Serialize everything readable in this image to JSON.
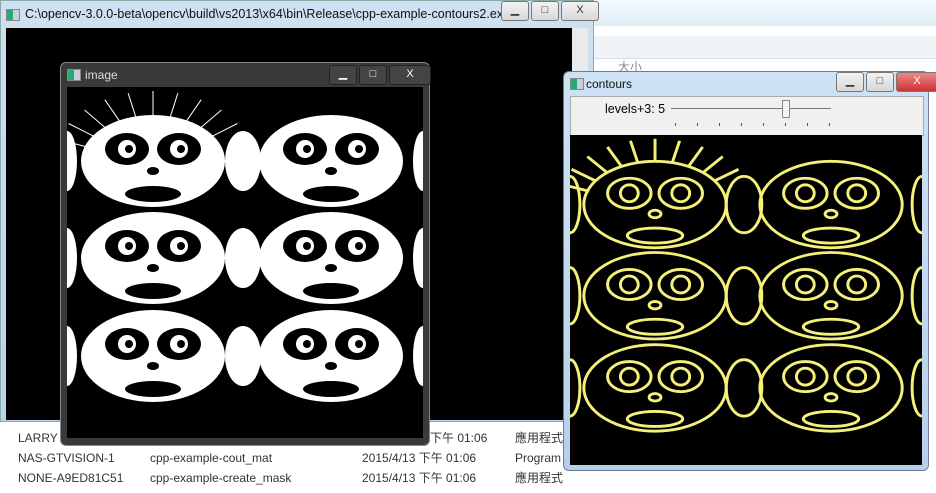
{
  "console": {
    "title": "C:\\opencv-3.0.0-beta\\opencv\\build\\vs2013\\x64\\bin\\Release\\cpp-example-contours2.exe"
  },
  "explorer": {
    "column_size": "大小",
    "nav": [
      "LARRY",
      "NAS-GTVISION-1",
      "NONE-A9ED81C51"
    ],
    "files": [
      {
        "name": "",
        "date": "下午 01:06",
        "type": "應用程式"
      },
      {
        "name": "cpp-example-cout_mat",
        "date": "2015/4/13 下午 01:06",
        "type": "Program"
      },
      {
        "name": "cpp-example-create_mask",
        "date": "2015/4/13 下午 01:06",
        "type": "應用程式"
      }
    ]
  },
  "image_window": {
    "title": "image"
  },
  "contours_window": {
    "title": "contours",
    "slider_label": "levels+3: 5",
    "slider_value": 5,
    "slider_max": 7
  },
  "window_buttons": {
    "minimize": "▁",
    "maximize": "□",
    "close": "X"
  },
  "colors": {
    "contour": "#f4f07a"
  }
}
